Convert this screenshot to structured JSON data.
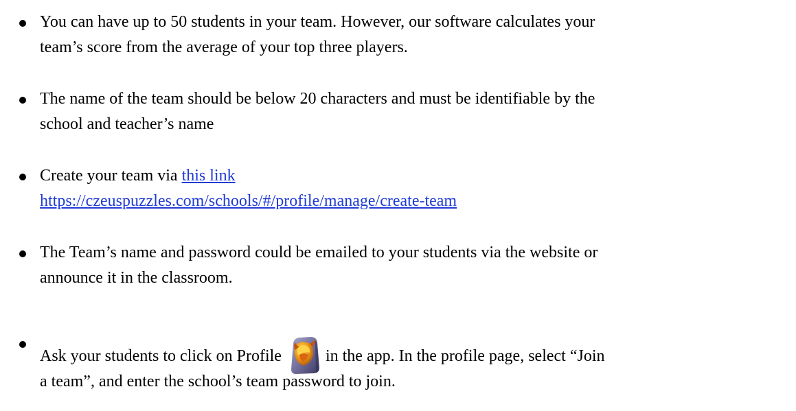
{
  "bullets": [
    {
      "lines": [
        "You can have up to 50 students in your team. However, our software calculates your",
        "team’s score from the average of your top three players."
      ]
    },
    {
      "lines": [
        "The name of the team should be below 20 characters and must be identifiable by the",
        "school and teacher’s name"
      ]
    },
    {
      "prefix": "Create your team via ",
      "link_text": "this link",
      "url_text": "https://czeuspuzzles.com/schools/#/profile/manage/create-team"
    },
    {
      "lines": [
        "The Team’s name and password could be emailed to your students via the website or",
        "announce it in the classroom."
      ]
    },
    {
      "before_icon": "Ask your students to click on Profile",
      "after_icon": "in the app. In the profile page, select “Join",
      "line2": "a team”, and enter the school’s team password to join.",
      "icon": "profile-shield-icon"
    }
  ],
  "colors": {
    "text": "#000000",
    "link": "#1f3bd6"
  }
}
